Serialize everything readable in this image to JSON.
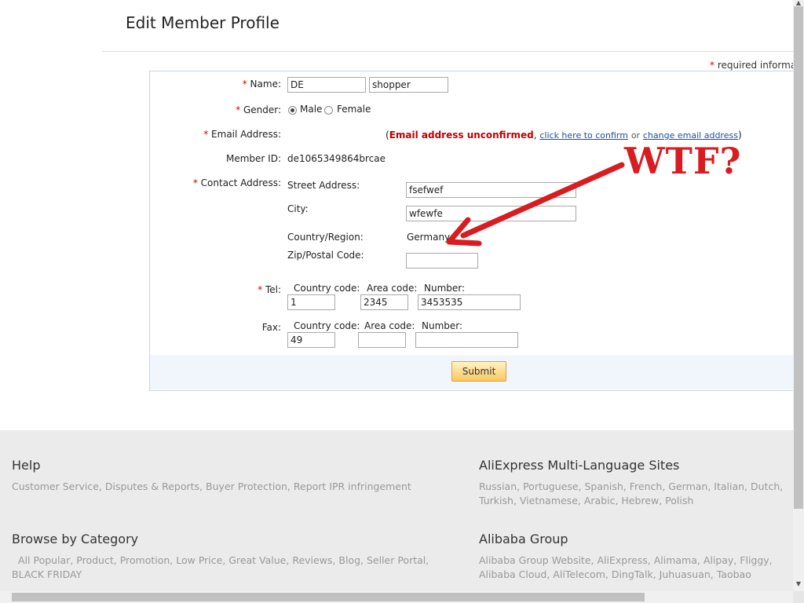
{
  "page": {
    "title": "Edit Member Profile",
    "required_note": "required information"
  },
  "form": {
    "name": {
      "label": "Name:",
      "first": "DE",
      "last": "shopper"
    },
    "gender": {
      "label": "Gender:",
      "male": "Male",
      "female": "Female",
      "selected": "Male"
    },
    "email": {
      "label": "Email Address:",
      "value": "",
      "status": "Email address unconfirmed",
      "confirm_link": "click here to confirm",
      "or": "or",
      "change_link": "change email address"
    },
    "member_id": {
      "label": "Member ID:",
      "value": "de1065349864brcae"
    },
    "contact": {
      "label": "Contact Address:",
      "street_label": "Street Address:",
      "street": "fsefwef",
      "city_label": "City:",
      "city": "wfewfe",
      "country_label": "Country/Region:",
      "country": "Germany",
      "zip_label": "Zip/Postal Code:",
      "zip": ""
    },
    "tel": {
      "label": "Tel:",
      "cc_label": "Country code:",
      "ac_label": "Area code:",
      "num_label": "Number:",
      "cc": "1",
      "ac": "2345",
      "num": "3453535"
    },
    "fax": {
      "label": "Fax:",
      "cc_label": "Country code:",
      "ac_label": "Area code:",
      "num_label": "Number:",
      "cc": "49",
      "ac": "",
      "num": ""
    },
    "submit": "Submit"
  },
  "annotation": {
    "text": "WTF?",
    "color": "#d81c20"
  },
  "footer": {
    "help": {
      "title": "Help",
      "links": "Customer Service, Disputes & Reports, Buyer Protection, Report IPR infringement"
    },
    "multilang": {
      "title": "AliExpress Multi-Language Sites",
      "links": "Russian, Portuguese, Spanish, French, German, Italian, Dutch, Turkish, Vietnamese, Arabic, Hebrew, Polish"
    },
    "browse": {
      "title": "Browse by Category",
      "links": "All Popular, Product, Promotion, Low Price, Great Value, Reviews, Blog, Seller Portal, BLACK FRIDAY"
    },
    "group": {
      "title": "Alibaba Group",
      "links": "Alibaba Group Website, AliExpress, Alimama, Alipay, Fliggy, Alibaba Cloud, AliTelecom, DingTalk, Juhuasuan, Taobao Marketplace, Tmall, Xiami,"
    }
  }
}
